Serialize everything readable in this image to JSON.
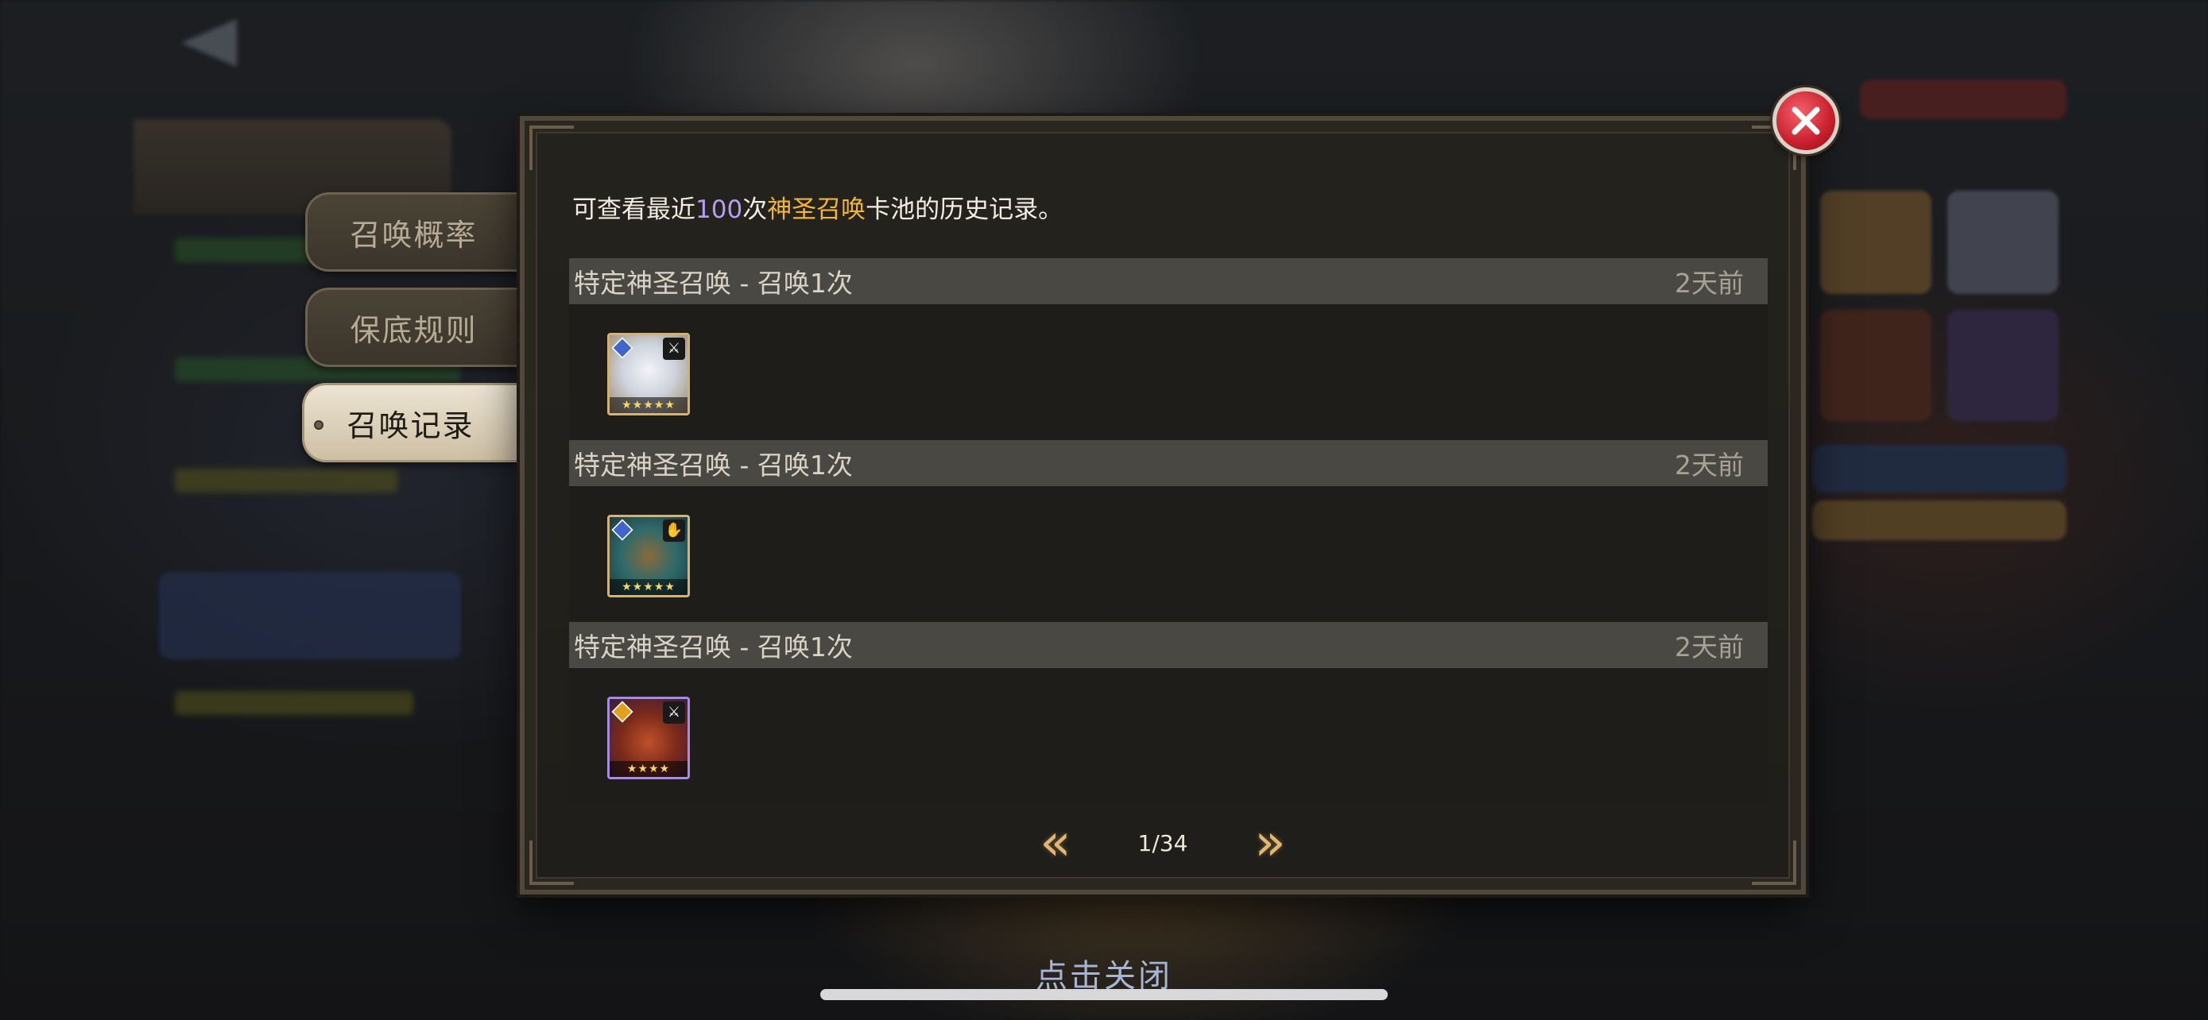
{
  "info": {
    "prefix": "可查看最近",
    "count": "100",
    "mid": "次",
    "pool": "神圣召唤",
    "suffix": "卡池的历史记录。"
  },
  "side_tabs": [
    {
      "label": "召唤概率",
      "active": false
    },
    {
      "label": "保底规则",
      "active": false
    },
    {
      "label": "召唤记录",
      "active": true
    }
  ],
  "records": [
    {
      "title": "特定神圣召唤 - 召唤1次",
      "time": "2天前",
      "hero_icon": "white-beast-hero-portrait",
      "stars": "★★★★★"
    },
    {
      "title": "特定神圣召唤 - 召唤1次",
      "time": "2天前",
      "hero_icon": "hooded-assassin-hero-portrait",
      "stars": "★★★★★"
    },
    {
      "title": "特定神圣召唤 - 召唤1次",
      "time": "2天前",
      "hero_icon": "red-dragon-warrior-hero-portrait",
      "stars": "★★★★"
    }
  ],
  "pagination": {
    "current": "1/34",
    "prev_icon": "double-chevron-left-icon",
    "next_icon": "double-chevron-right-icon"
  },
  "close_hint": "点击关闭",
  "colors": {
    "accent_purple": "#b79cf3",
    "accent_gold": "#f3b43a",
    "close_red": "#c91f2d"
  }
}
